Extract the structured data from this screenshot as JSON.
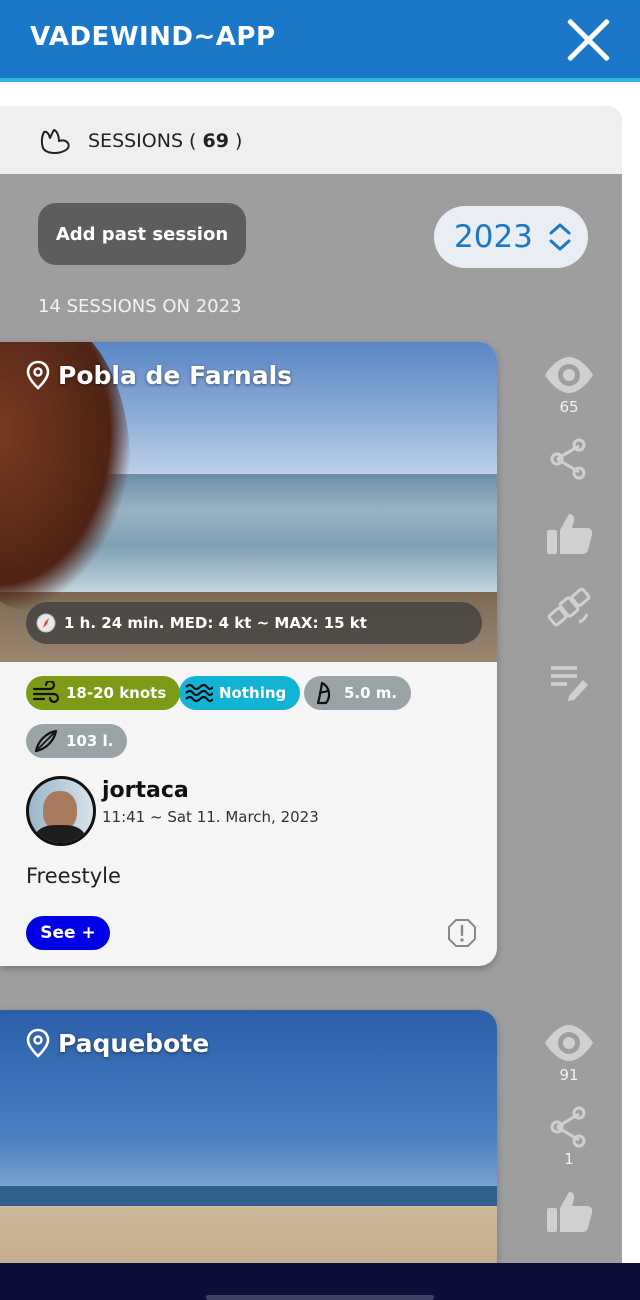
{
  "app": {
    "title": "VADEWIND~APP"
  },
  "panel": {
    "title_prefix": "SESSIONS (",
    "title_count": "69",
    "title_suffix": ")",
    "add_button": "Add past session",
    "year": "2023",
    "year_summary": "14 SESSIONS ON 2023"
  },
  "sessions": [
    {
      "place": "Pobla de Farnals",
      "stats": "1 h. 24 min. MED: 4 kt ~ MAX: 15 kt",
      "wind": "18-20 knots",
      "waves": "Nothing",
      "sail": "5.0 m.",
      "board": "103 l.",
      "user": "jortaca",
      "time": "11:41 ~ Sat 11. March, 2023",
      "comment": "Freestyle",
      "see_button": "See +",
      "views": "65"
    },
    {
      "place": "Paquebote",
      "views": "91",
      "shares": "1"
    }
  ],
  "colors": {
    "header": "#1b78c8",
    "panel": "#9e9e9e",
    "wind_chip": "#7e9b17",
    "waves_chip": "#13b3d6",
    "equip_chip": "#9aa3a6",
    "see_button": "#0000e6"
  },
  "icons": [
    "close-icon",
    "hand-icon",
    "chevron-updown-icon",
    "location-pin-icon",
    "compass-icon",
    "wind-icon",
    "waves-icon",
    "sail-icon",
    "board-icon",
    "report-icon",
    "eye-icon",
    "share-icon",
    "thumbs-up-icon",
    "satellite-icon",
    "edit-list-icon"
  ]
}
